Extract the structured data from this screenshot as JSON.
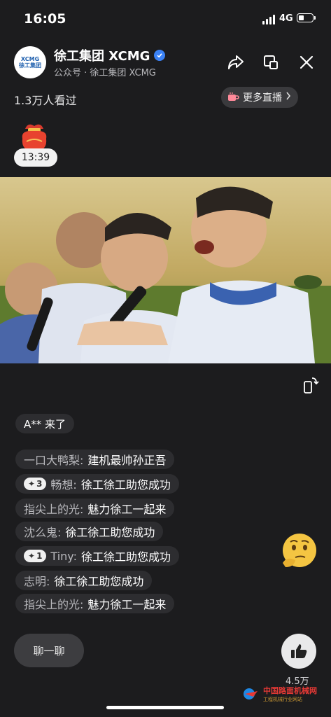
{
  "status": {
    "time": "16:05",
    "network": "4G"
  },
  "header": {
    "logo_top": "XCMG",
    "logo_bottom": "徐工集团",
    "account_name": "徐工集团 XCMG",
    "account_sub": "公众号 · 徐工集团 XCMG",
    "icons": [
      "share-icon",
      "float-window-icon",
      "close-icon"
    ]
  },
  "live": {
    "views": "1.3万人看过",
    "more_live": "更多直播",
    "countdown": "13:39"
  },
  "chat": {
    "join_notice": "A** 来了",
    "messages": [
      {
        "user": "一口大鸭梨:",
        "text": "建机最帅孙正吾",
        "badge": ""
      },
      {
        "user": "畅想:",
        "text": "徐工徐工助您成功",
        "badge": "3"
      },
      {
        "user": "指尖上的光:",
        "text": "魅力徐工一起来",
        "badge": ""
      },
      {
        "user": "沈么鬼:",
        "text": "徐工徐工助您成功",
        "badge": ""
      },
      {
        "user": "Tiny:",
        "text": "徐工徐工助您成功",
        "badge": "1"
      },
      {
        "user": "志明:",
        "text": "徐工徐工助您成功",
        "badge": ""
      },
      {
        "user": "指尖上的光:",
        "text": "魅力徐工一起来",
        "badge": ""
      }
    ]
  },
  "footer": {
    "chat_button": "聊一聊",
    "likes": "4.5万",
    "watermark_main": "中国路面机械网",
    "watermark_sub": "工程机械行业网站"
  },
  "colors": {
    "background": "#1c1c1e",
    "verified": "#3b82f6",
    "bubble": "#2d2d30"
  }
}
